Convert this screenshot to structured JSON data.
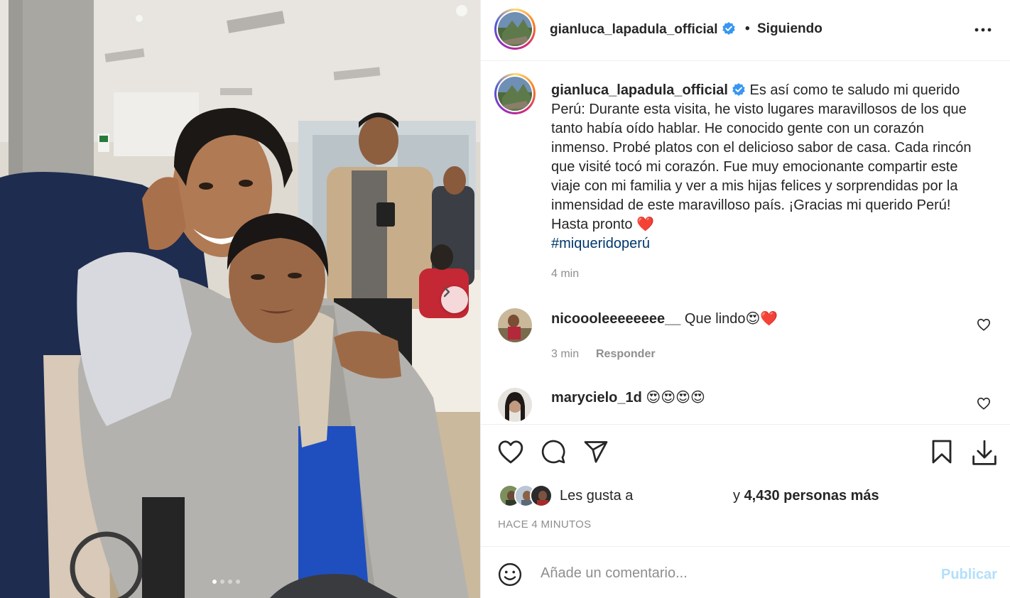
{
  "post": {
    "username": "gianluca_lapadula_official",
    "follow_status": "Siguiendo",
    "separator": "•",
    "caption_text": "Es así como te saludo mi querido Perú: Durante esta visita, he visto lugares maravillosos de los que tanto había oído hablar. He conocido gente con un corazón inmenso. Probé platos con el delicioso sabor de casa. Cada rincón que visité tocó mi corazón. Fue muy emocionante compartir este viaje con mi familia y ver a mis hijas felices y sorprendidas por la inmensidad de este maravilloso país. ¡Gracias mi querido Perú! Hasta pronto ",
    "caption_emoji": "❤️",
    "hashtag": "#miqueridoperú",
    "caption_time": "4 min",
    "carousel": {
      "total_slides": 4,
      "active_slide": 1
    }
  },
  "comments": [
    {
      "username": "nicoooleeeeeeee__",
      "text": "Que lindo😍❤️",
      "time": "3 min",
      "reply_label": "Responder"
    },
    {
      "username": "marycielo_1d",
      "text": "😍😍😍😍"
    }
  ],
  "likes": {
    "prefix": "Les gusta a",
    "connector": "y",
    "count_text": "4,430 personas más"
  },
  "timestamp": "HACE 4 MINUTOS",
  "add_comment": {
    "placeholder": "Añade un comentario...",
    "publish_label": "Publicar"
  },
  "icons": [
    "verified-badge-icon",
    "more-options-icon",
    "heart-icon",
    "comment-icon",
    "share-icon",
    "bookmark-icon",
    "download-icon",
    "emoji-icon",
    "chevron-right-icon"
  ],
  "colors": {
    "verified": "#3897f0",
    "link": "#00376b",
    "publish_disabled": "#b2dffc",
    "muted": "#8e8e8e"
  }
}
